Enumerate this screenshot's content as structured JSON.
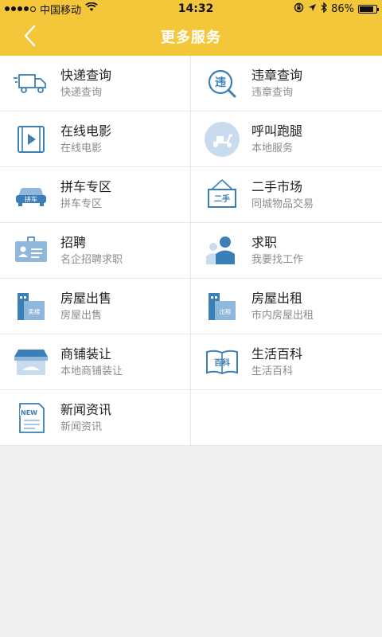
{
  "status": {
    "carrier": "中国移动",
    "time": "14:32",
    "battery_text": "86%",
    "battery_level": 0.86
  },
  "header": {
    "title": "更多服务"
  },
  "colors": {
    "accent": "#f4c73a",
    "icon_blue": "#3a7fb8"
  },
  "services": [
    {
      "title": "快递查询",
      "subtitle": "快递查询",
      "icon": "truck-icon"
    },
    {
      "title": "违章查询",
      "subtitle": "违章查询",
      "icon": "violation-search-icon"
    },
    {
      "title": "在线电影",
      "subtitle": "在线电影",
      "icon": "film-play-icon"
    },
    {
      "title": "呼叫跑腿",
      "subtitle": "本地服务",
      "icon": "scooter-icon"
    },
    {
      "title": "拼车专区",
      "subtitle": "拼车专区",
      "icon": "carpool-car-icon",
      "icon_text": "拼车"
    },
    {
      "title": "二手市场",
      "subtitle": "同城物品交易",
      "icon": "second-hand-sign-icon",
      "icon_text": "二手"
    },
    {
      "title": "招聘",
      "subtitle": "名企招聘求职",
      "icon": "id-badge-icon"
    },
    {
      "title": "求职",
      "subtitle": "我要找工作",
      "icon": "people-icon"
    },
    {
      "title": "房屋出售",
      "subtitle": "房屋出售",
      "icon": "building-sale-icon",
      "icon_text": "卖楼"
    },
    {
      "title": "房屋出租",
      "subtitle": "市内房屋出租",
      "icon": "building-rent-icon",
      "icon_text": "出租"
    },
    {
      "title": "商铺装让",
      "subtitle": "本地商铺装让",
      "icon": "shop-icon"
    },
    {
      "title": "生活百科",
      "subtitle": "生活百科",
      "icon": "encyclopedia-book-icon",
      "icon_text": "百科"
    },
    {
      "title": "新闻资讯",
      "subtitle": "新闻资讯",
      "icon": "news-document-icon",
      "icon_text": "NEW"
    }
  ]
}
